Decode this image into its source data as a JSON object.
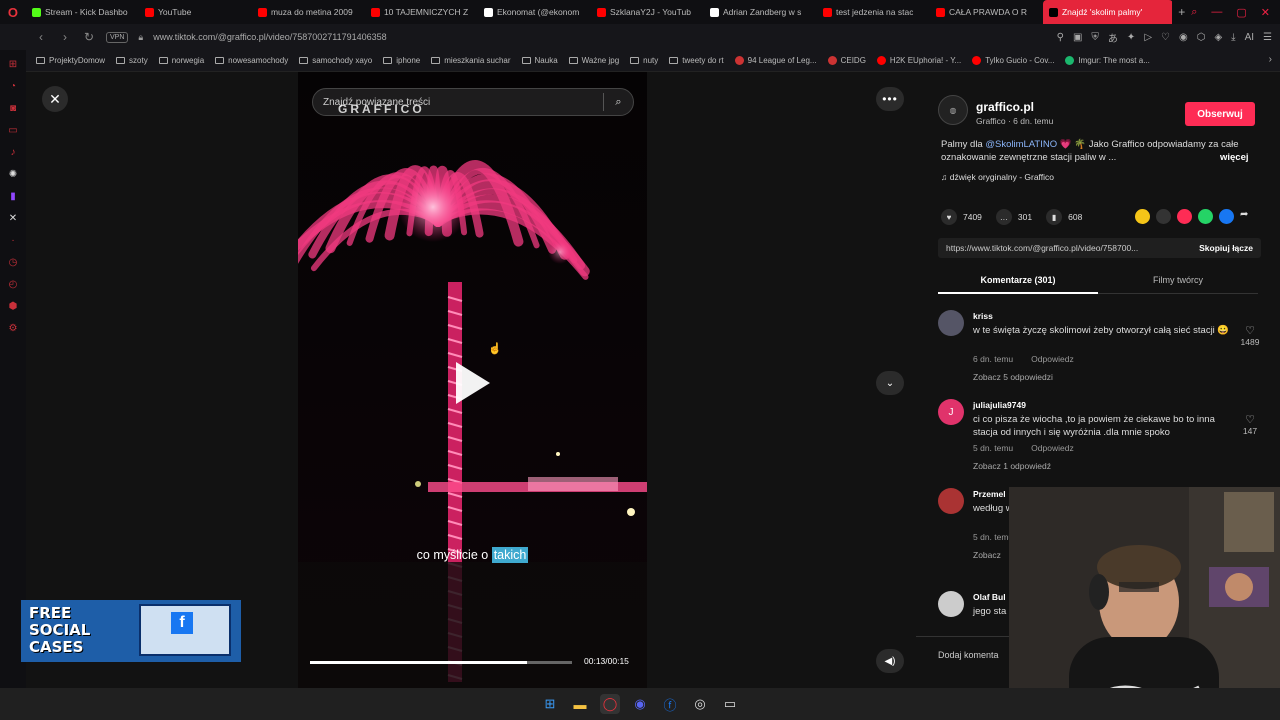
{
  "browser": {
    "tabs": [
      {
        "label": "Stream - Kick Dashbo",
        "color": "#53fc18"
      },
      {
        "label": "YouTube",
        "color": "#ff0000"
      },
      {
        "label": "muza do metina 2009",
        "color": "#ff0000"
      },
      {
        "label": "10 TAJEMNICZYCH Z",
        "color": "#ff0000"
      },
      {
        "label": "Ekonomat (@ekonom",
        "color": "#ffffff"
      },
      {
        "label": "SzklanaY2J - YouTub",
        "color": "#ff0000"
      },
      {
        "label": "Adrian Zandberg w s",
        "color": "#ffffff"
      },
      {
        "label": "test jedzenia na stac",
        "color": "#ff0000"
      },
      {
        "label": "CAŁA PRAWDA O R",
        "color": "#ff0000"
      },
      {
        "label": "Znajdź 'skolim palmy'",
        "color": "#000000",
        "active": true
      }
    ],
    "new_tab": "+",
    "vpn": "VPN",
    "url": "www.tiktok.com/@graffico.pl/video/7587002711791406358",
    "ai_label": "AI"
  },
  "bookmarks": [
    {
      "label": "ProjektyDomow",
      "icon": "folder-icon"
    },
    {
      "label": "szoty",
      "icon": "folder-icon"
    },
    {
      "label": "norwegia",
      "icon": "folder-icon"
    },
    {
      "label": "nowesamochody",
      "icon": "folder-icon"
    },
    {
      "label": "samochody xayo",
      "icon": "folder-icon"
    },
    {
      "label": "iphone",
      "icon": "folder-icon"
    },
    {
      "label": "mieszkania suchar",
      "icon": "folder-icon"
    },
    {
      "label": "Nauka",
      "icon": "folder-icon"
    },
    {
      "label": "Ważne jpg",
      "icon": "folder-icon"
    },
    {
      "label": "nuty",
      "icon": "folder-icon"
    },
    {
      "label": "tweety do rt",
      "icon": "folder-icon"
    },
    {
      "label": "94 League of Leg...",
      "icon": "lol-icon"
    },
    {
      "label": "CEIDG",
      "icon": "ceidg-icon"
    },
    {
      "label": "H2K EUphoria! - Y...",
      "icon": "youtube-icon"
    },
    {
      "label": "Tylko Gucio - Cov...",
      "icon": "youtube-icon"
    },
    {
      "label": "Imgur: The most a...",
      "icon": "imgur-icon"
    }
  ],
  "video": {
    "search_placeholder": "Znajdź powiązane treści",
    "watermark": "GRAFFICO",
    "caption_before": "co myślicie o",
    "caption_highlight": "takich",
    "timecode": "00:13/00:15",
    "progress": 0.83
  },
  "ad": {
    "line1": "FREE",
    "line2": "SOCIAL",
    "line3": "CASES"
  },
  "post": {
    "username": "graffico.pl",
    "subline": "Graffico · 6 dn. temu",
    "follow": "Obserwuj",
    "desc_before": "Palmy dla",
    "mention": "@SkolimLATINO",
    "desc_after": "💗 🌴 Jako Graffico odpowiadamy za całe oznakowanie zewnętrzne stacji paliw w ...",
    "more": "więcej",
    "sound": "dźwięk oryginalny - Graffico",
    "likes": "7409",
    "comments": "301",
    "saves": "608",
    "link": "https://www.tiktok.com/@graffico.pl/video/758700...",
    "copy": "Skopiuj łącze",
    "tab_comments": "Komentarze (301)",
    "tab_creator": "Filmy twórcy",
    "add_comment": "Dodaj komenta"
  },
  "comments": [
    {
      "user": "kriss",
      "text": "w te święta życzę skolimowi żeby otworzył całą sieć stacji 😀",
      "time": "6 dn. temu",
      "reply": "Odpowiedz",
      "replies": "Zobacz 5 odpowiedzi",
      "likes": "1489",
      "avatar": "#556"
    },
    {
      "user": "juliajulia9749",
      "text": "ci co pisza że wiocha ,to ja powiem że ciekawe bo to inna stacja od innych i się wyróżnia .dla mnie spoko",
      "time": "5 dn. temu",
      "reply": "Odpowiedz",
      "replies": "Zobacz 1 odpowiedź",
      "likes": "147",
      "avatar": "#e0336b",
      "initial": "J"
    },
    {
      "user": "Przemel",
      "text": "według wszędz 😍",
      "time": "5 dn. temu",
      "reply": "",
      "replies": "Zobacz",
      "likes": "",
      "avatar": "#a33"
    },
    {
      "user": "Olaf Bul",
      "text": "jego sta coś fan",
      "time": "",
      "reply": "",
      "replies": "",
      "likes": "",
      "avatar": "#ccc"
    }
  ],
  "taskbar": [
    "windows-start-icon",
    "file-explorer-icon",
    "opera-gx-icon",
    "discord-icon",
    "facebook-icon",
    "obs-icon",
    "terminal-icon"
  ]
}
